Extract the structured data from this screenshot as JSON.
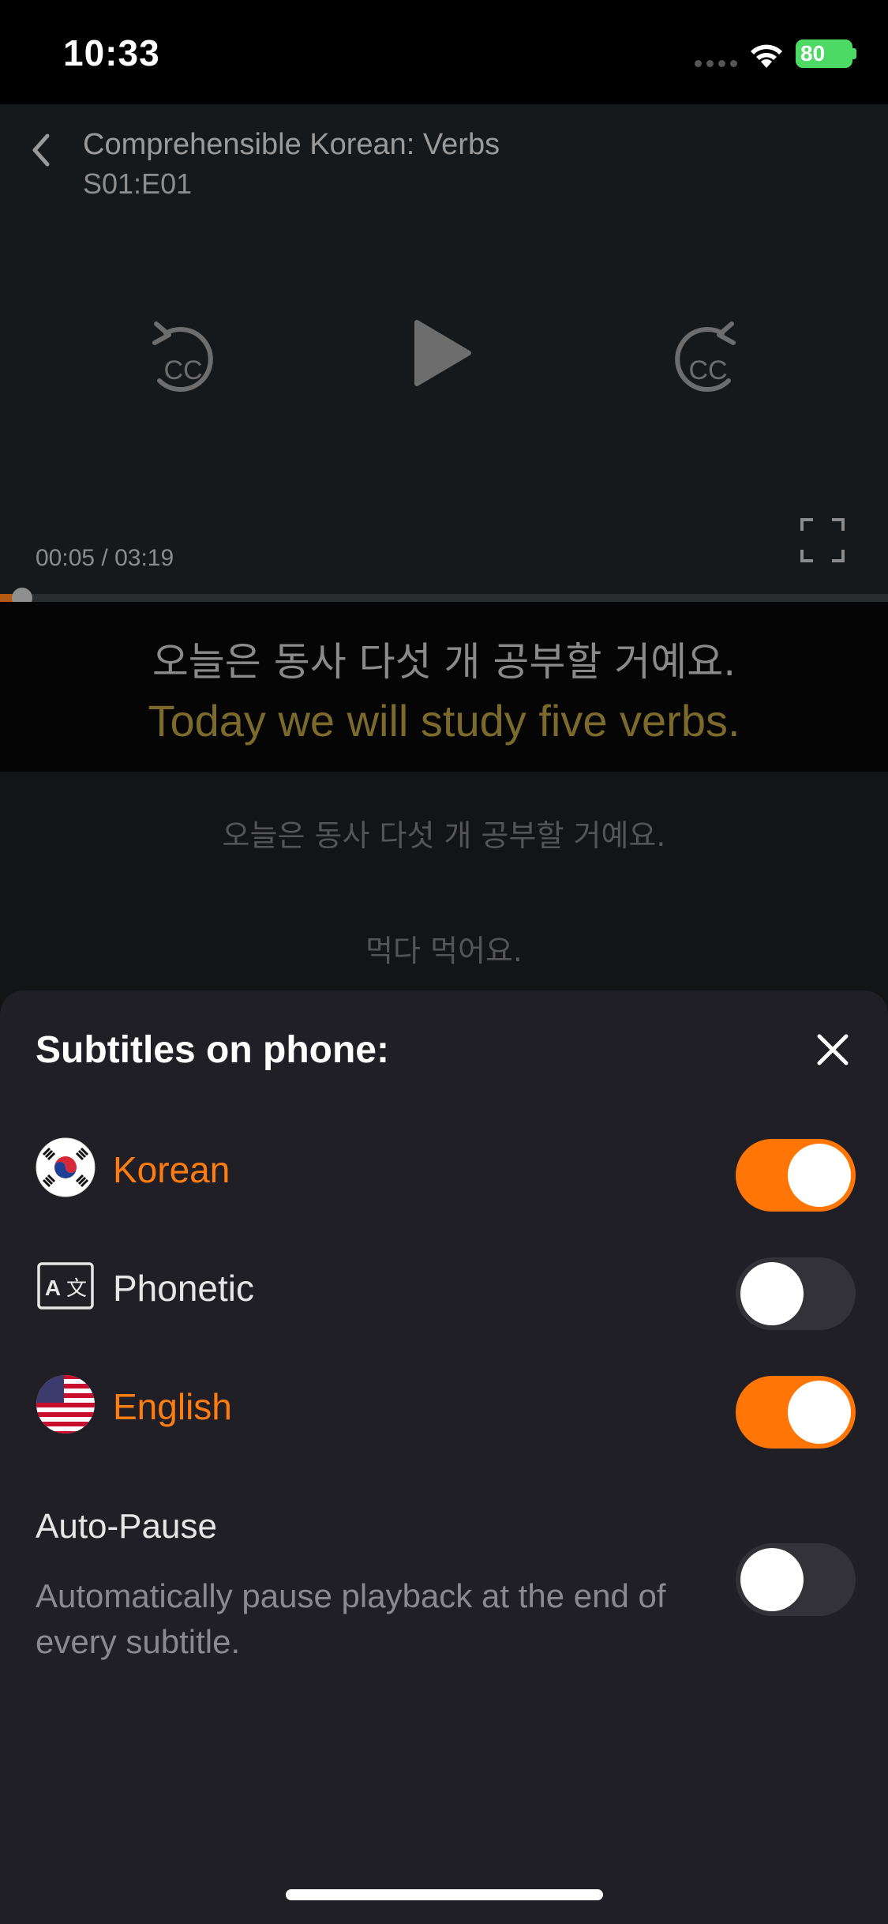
{
  "status_bar": {
    "time": "10:33",
    "battery": "80"
  },
  "player": {
    "title": "Comprehensible Korean: Verbs",
    "episode": "S01:E01",
    "time_readout": "00:05 / 03:19",
    "progress": 0.025
  },
  "subtitles": {
    "korean": "오늘은 동사 다섯 개 공부할 거예요.",
    "english": "Today we will study five verbs."
  },
  "transcript": [
    "오늘은 동사 다섯 개 공부할 거예요.",
    "먹다 먹어요."
  ],
  "sheet": {
    "title": "Subtitles on phone:",
    "options": [
      {
        "label": "Korean",
        "enabled": true,
        "icon": "korea-flag-icon"
      },
      {
        "label": "Phonetic",
        "enabled": false,
        "icon": "translate-icon"
      },
      {
        "label": "English",
        "enabled": true,
        "icon": "us-flag-icon"
      }
    ],
    "auto_pause": {
      "title": "Auto-Pause",
      "description": "Automatically pause playback at the end of every subtitle.",
      "enabled": false
    }
  },
  "colors": {
    "accent": "#ff7506",
    "sheet_bg": "#211f26"
  }
}
